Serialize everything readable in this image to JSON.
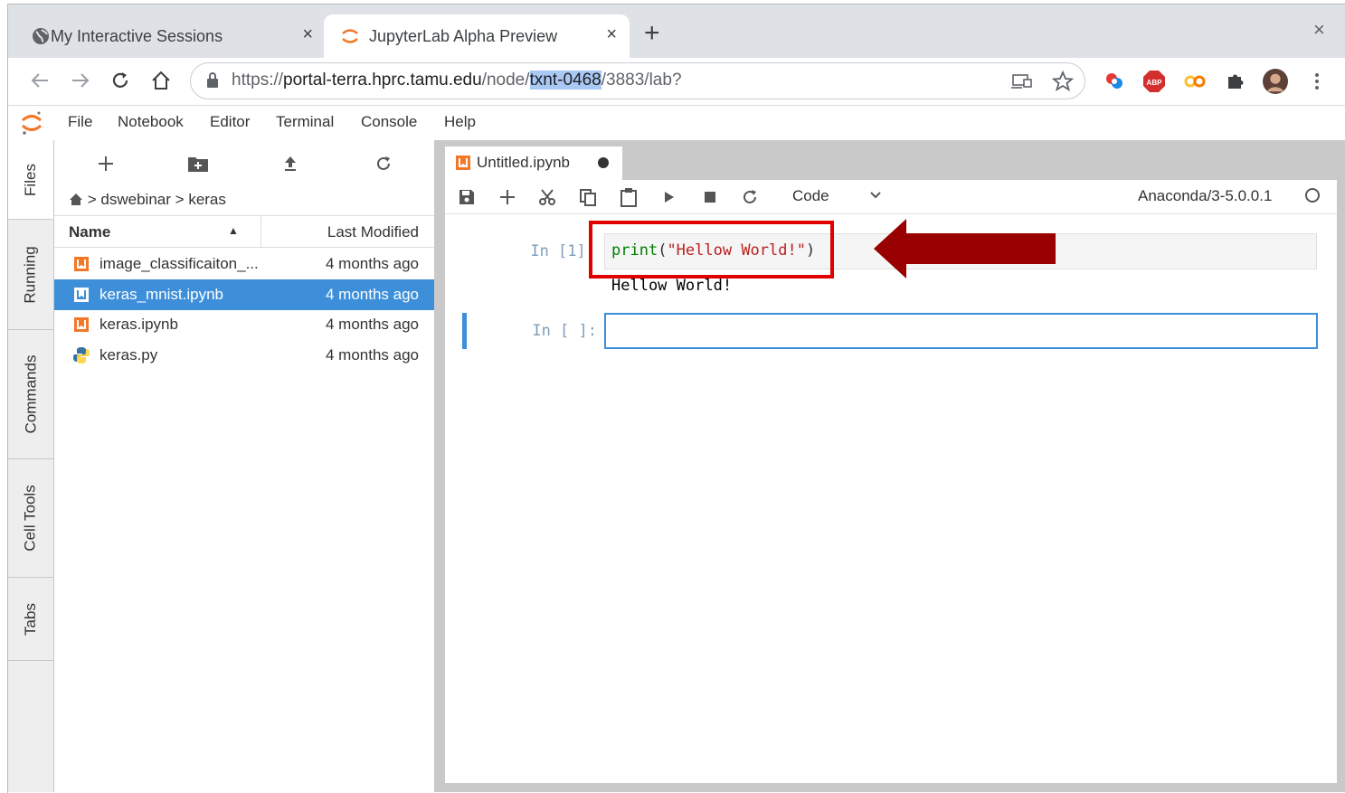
{
  "browser": {
    "tabs": [
      {
        "title": "My Interactive Sessions",
        "close": "×"
      },
      {
        "title": "JupyterLab Alpha Preview",
        "close": "×"
      }
    ],
    "new_tab": "+",
    "window_close": "×",
    "url": {
      "scheme": "https://",
      "host": "portal-terra.hprc.tamu.edu",
      "path_before": "/node/",
      "path_highlight": "txnt-0468",
      "path_after": "/3883/lab?"
    },
    "colors": {
      "selection": "#a9c8f4",
      "tabstrip": "#dee1e6"
    }
  },
  "jupyter": {
    "menu": [
      "File",
      "Notebook",
      "Editor",
      "Terminal",
      "Console",
      "Help"
    ],
    "side_tabs": [
      "Files",
      "Running",
      "Commands",
      "Cell Tools",
      "Tabs"
    ],
    "file_browser": {
      "breadcrumb_sep": ">",
      "breadcrumb": [
        "dswebinar",
        "keras"
      ],
      "columns": {
        "name": "Name",
        "modified": "Last Modified"
      },
      "files": [
        {
          "name": "image_classificaiton_...",
          "modified": "4 months ago",
          "icon": "notebook-icon"
        },
        {
          "name": "keras_mnist.ipynb",
          "modified": "4 months ago",
          "icon": "notebook-icon",
          "selected": true
        },
        {
          "name": "keras.ipynb",
          "modified": "4 months ago",
          "icon": "notebook-icon"
        },
        {
          "name": "keras.py",
          "modified": "4 months ago",
          "icon": "python-icon"
        }
      ]
    },
    "notebook": {
      "tab_title": "Untitled.ipynb",
      "cell_type": "Code",
      "kernel": "Anaconda/3-5.0.0.1",
      "cells": [
        {
          "prompt": "In [1]:",
          "code": {
            "fn": "print",
            "open": "(",
            "str": "\"Hellow World!\"",
            "close": ")"
          },
          "output": "Hellow World!"
        },
        {
          "prompt": "In [ ]:",
          "code": ""
        }
      ]
    },
    "colors": {
      "accent": "#3d8fd9",
      "orange": "#f37726",
      "annotation_red": "#e00000",
      "arrow": "#990000"
    }
  }
}
